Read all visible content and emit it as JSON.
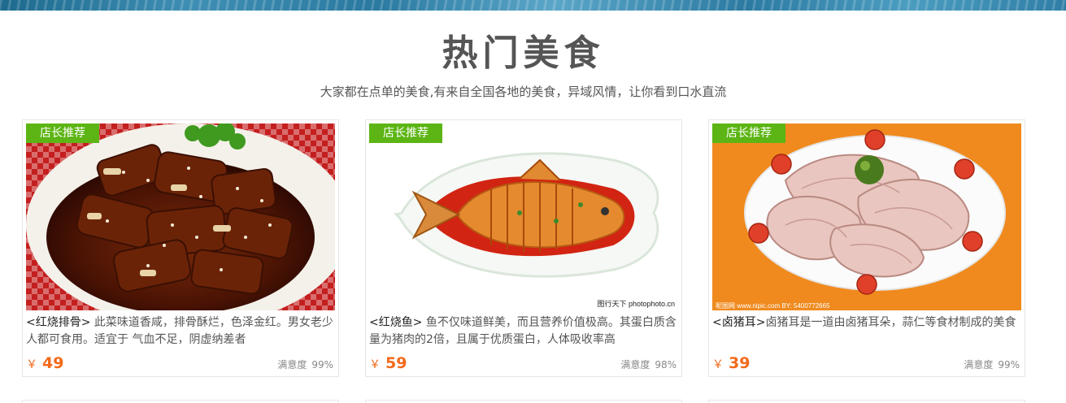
{
  "section": {
    "title": "热门美食",
    "subtitle": "大家都在点单的美食,有来自全国各地的美食，异域风情，让你看到口水直流"
  },
  "cards": [
    {
      "badge": "店长推荐",
      "name": "<红烧排骨>",
      "description": " 此菜味道香咸，排骨酥烂，色泽金红。男女老少人都可食用。适宜于 气血不足，阴虚纳差者",
      "currency": "￥",
      "price": "49",
      "satisfaction_label": "满意度",
      "satisfaction_value": "99%"
    },
    {
      "badge": "店长推荐",
      "name": "<红烧鱼>",
      "description": " 鱼不仅味道鲜美，而且营养价值极高。其蛋白质含量为猪肉的2倍，且属于优质蛋白，人体吸收率高",
      "currency": "￥",
      "price": "59",
      "satisfaction_label": "满意度",
      "satisfaction_value": "98%",
      "watermark": "图行天下 photophoto.cn"
    },
    {
      "badge": "店长推荐",
      "name": "<卤猪耳>",
      "description": "卤猪耳是一道由卤猪耳朵，蒜仁等食材制成的美食",
      "currency": "￥",
      "price": "39",
      "satisfaction_label": "满意度",
      "satisfaction_value": "99%",
      "watermark": "昵图网 www.nipic.com   BY: 5400772665"
    }
  ],
  "colors": {
    "badge_green": "#5cb514",
    "price_orange": "#f26a1b"
  }
}
